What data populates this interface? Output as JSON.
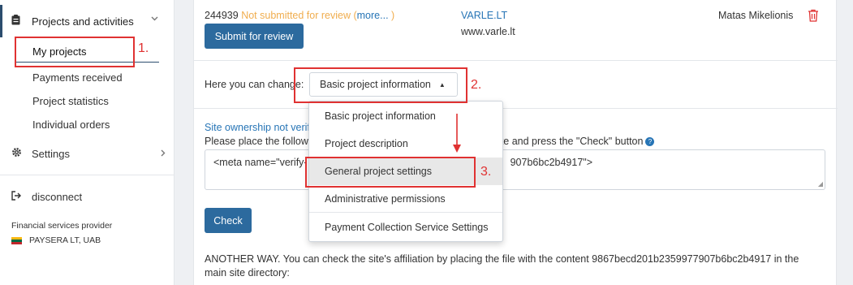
{
  "sidebar": {
    "section_title": "Projects and activities",
    "items": [
      {
        "label": "My projects"
      },
      {
        "label": "Payments received"
      },
      {
        "label": "Project statistics"
      },
      {
        "label": "Individual orders"
      }
    ],
    "settings_label": "Settings",
    "disconnect_label": "disconnect",
    "provider_label": "Financial services provider",
    "company_name": "PAYSERA LT, UAB"
  },
  "project": {
    "id": "244939",
    "status": "Not submitted for review",
    "more_open": "(",
    "more_link": "more...",
    "more_close": ")",
    "submit_label": "Submit for review",
    "site_name": "VARLE.LT",
    "site_url": "www.varle.lt",
    "owner": "Matas Mikelionis"
  },
  "change": {
    "label": "Here you can change:",
    "selected": "Basic project information"
  },
  "dropdown": {
    "options": [
      "Basic project information",
      "Project description",
      "General project settings",
      "Administrative permissions",
      "Payment Collection Service Settings"
    ]
  },
  "ownership": {
    "warning": "Site ownership not verif",
    "instruction_start": "Please place the follow",
    "instruction_end": "website and press the \"Check\" button",
    "meta_start": "<meta name=\"verify-",
    "meta_end": "907b6bc2b4917\">",
    "check_label": "Check",
    "another_way": "ANOTHER WAY. You can check the site's affiliation by placing the file with the content 9867becd201b2359977907b6bc2b4917 in the main site directory:"
  },
  "annotations": {
    "one": "1.",
    "two": "2.",
    "three": "3."
  },
  "colors": {
    "primary_button": "#2c6a9e",
    "link": "#2775b6",
    "warning": "#f0ad4e",
    "delete": "#e03232",
    "annotation": "#e03232"
  }
}
